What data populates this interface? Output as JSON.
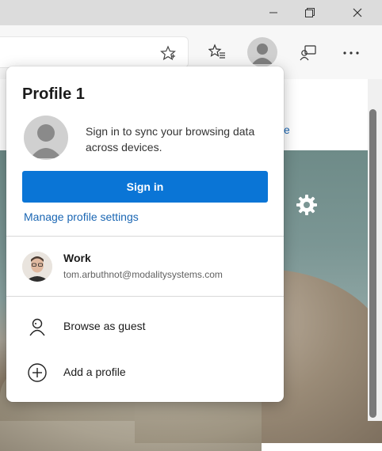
{
  "browser": {
    "window_controls": {
      "minimize_icon": "minimize-icon",
      "maximize_icon": "restore-icon",
      "close_icon": "close-icon"
    },
    "toolbar": {
      "favorite_icon": "star-icon",
      "favorites_icon": "favorites-list-icon",
      "profile_icon": "profile-avatar-icon",
      "feedback_icon": "feedback-icon",
      "more_icon": "more-dots-icon"
    }
  },
  "page": {
    "partial_link": "e",
    "settings_icon": "gear-icon"
  },
  "profile_flyout": {
    "title": "Profile 1",
    "sync_message": "Sign in to sync your browsing data across devices.",
    "sign_in_label": "Sign in",
    "manage_link": "Manage profile settings",
    "other_profiles": [
      {
        "name": "Work",
        "email": "tom.arbuthnot@modalitysystems.com"
      }
    ],
    "actions": [
      {
        "label": "Browse as guest",
        "icon": "guest-icon"
      },
      {
        "label": "Add a profile",
        "icon": "add-circle-icon"
      }
    ]
  },
  "colors": {
    "accent": "#0a75d6",
    "link": "#1a66b3"
  }
}
